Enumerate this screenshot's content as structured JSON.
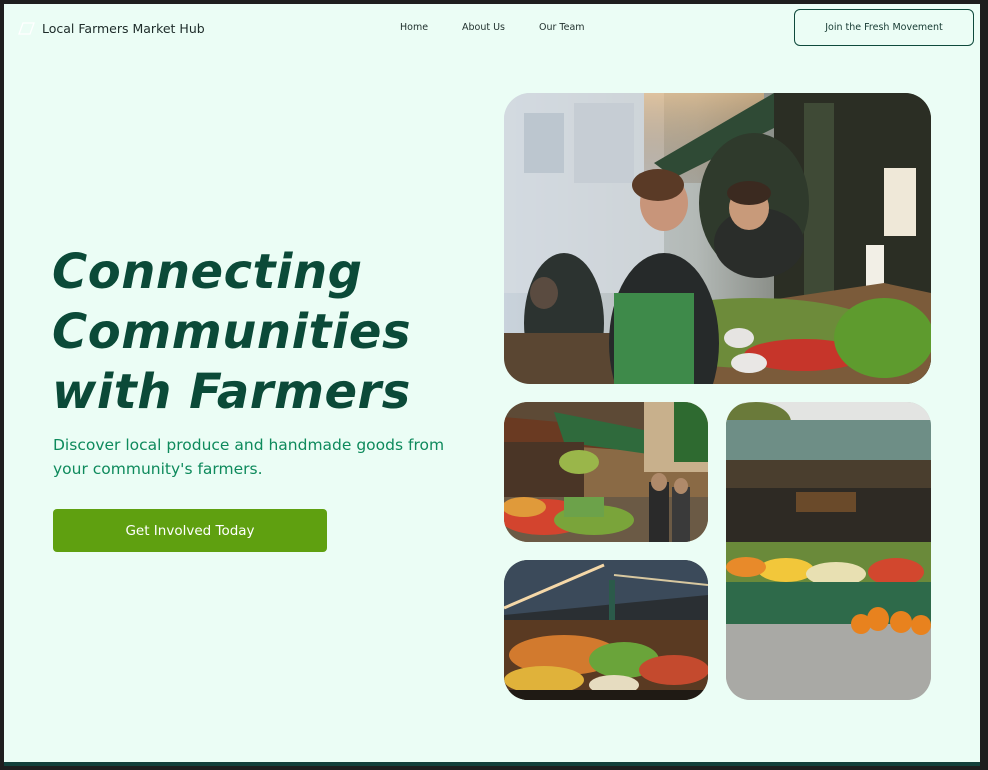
{
  "header": {
    "logo_icon": "leaf-outline-icon",
    "brand": "Local Farmers Market Hub",
    "nav": [
      {
        "label": "Home"
      },
      {
        "label": "About Us"
      },
      {
        "label": "Our Team"
      }
    ],
    "cta_label": "Join the Fresh Movement"
  },
  "hero": {
    "title_lines": [
      "Connecting",
      "Communities",
      "with Farmers"
    ],
    "subtitle": "Discover local produce and handmade goods from your community's farmers.",
    "button_label": "Get Involved Today"
  },
  "gallery": {
    "images": [
      {
        "name": "vendor-at-market-stall-photo"
      },
      {
        "name": "market-street-photo"
      },
      {
        "name": "outdoor-produce-stand-photo"
      },
      {
        "name": "indoor-market-hall-photo"
      }
    ]
  },
  "colors": {
    "page_bg": "#ebfdf5",
    "title": "#0b4a38",
    "subtitle": "#0e8a5c",
    "button": "#5fa010",
    "dark_frame": "#1e1e1e"
  }
}
